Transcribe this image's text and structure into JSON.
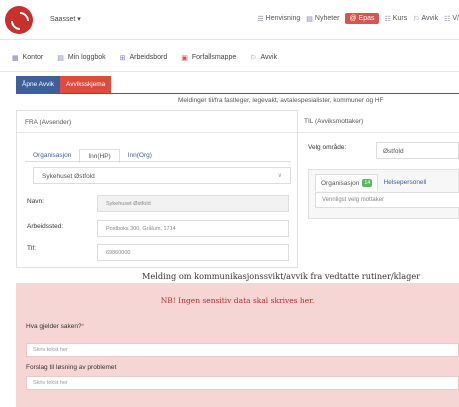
{
  "topbar": {
    "org_select": "Saasset ▾",
    "nav": [
      {
        "icon": "list-icon",
        "glyph": "☰",
        "label": "Henvisning",
        "active": false
      },
      {
        "icon": "news-icon",
        "glyph": "▤",
        "label": "Nyheter",
        "active": false
      },
      {
        "icon": "epost-icon",
        "glyph": "@",
        "label": "Epas",
        "active": true
      },
      {
        "icon": "kurs-icon",
        "glyph": "☷",
        "label": "Kurs",
        "active": false
      },
      {
        "icon": "avvik-icon",
        "glyph": "⚐",
        "label": "Avvik",
        "active": false
      },
      {
        "icon": "more-icon",
        "glyph": "☷",
        "label": "V/",
        "active": false
      }
    ]
  },
  "secnav": [
    {
      "label": "Kontor",
      "glyph": "▦"
    },
    {
      "label": "Min loggbok",
      "glyph": "▤"
    },
    {
      "label": "Arbeidsbord",
      "glyph": "⊞"
    },
    {
      "label": "Forfallsmappe",
      "glyph": "▣"
    },
    {
      "label": "Avvik",
      "glyph": "⚐"
    }
  ],
  "tabs": {
    "open": "Åpne Avvik",
    "form": "Avviksskjema"
  },
  "subheader": "Meldinger til/fra fastleger, legevakt, avtalespesialister, kommuner og HF",
  "fra": {
    "heading": "FRA (Avsender)",
    "org_tabs": [
      "Organisasjon",
      "Inn(HP)",
      "Inn(Org)"
    ],
    "hospital": "Sykehuset Østfold",
    "navn_label": "Navn:",
    "navn_value": "Sykehuset Østfold",
    "arbeidssted_label": "Arbeidssted:",
    "arbeidssted_value": "Postboks 300, Grålum, 1714",
    "tlf_label": "Tlf:",
    "tlf_value": "69860000"
  },
  "til": {
    "heading": "TIL (Avviksmottaker)",
    "omrade_label": "Velg område:",
    "omrade_value": "Østfold",
    "tab_org": "Organisasjon",
    "tab_org_count": "14",
    "tab_hp": "Helsepersonell",
    "mottaker_placeholder": "Vennligst velg mottaker"
  },
  "section_title": "Melding om kommunikasjonssvikt/avvik fra vedtatte rutiner/klager",
  "warning": "NB! Ingen sensitiv data skal skrives her.",
  "questions": [
    {
      "label": "Hva gjelder saken?",
      "required": "*",
      "placeholder": "Skriv tekst her"
    },
    {
      "label": "Forslag til løsning av problemet",
      "required": "",
      "placeholder": "Skriv tekst her"
    }
  ],
  "colors": {
    "accent_red": "#e04b3f",
    "tab_blue": "#3e5f9a",
    "pink_bg": "#f5d6d5"
  }
}
